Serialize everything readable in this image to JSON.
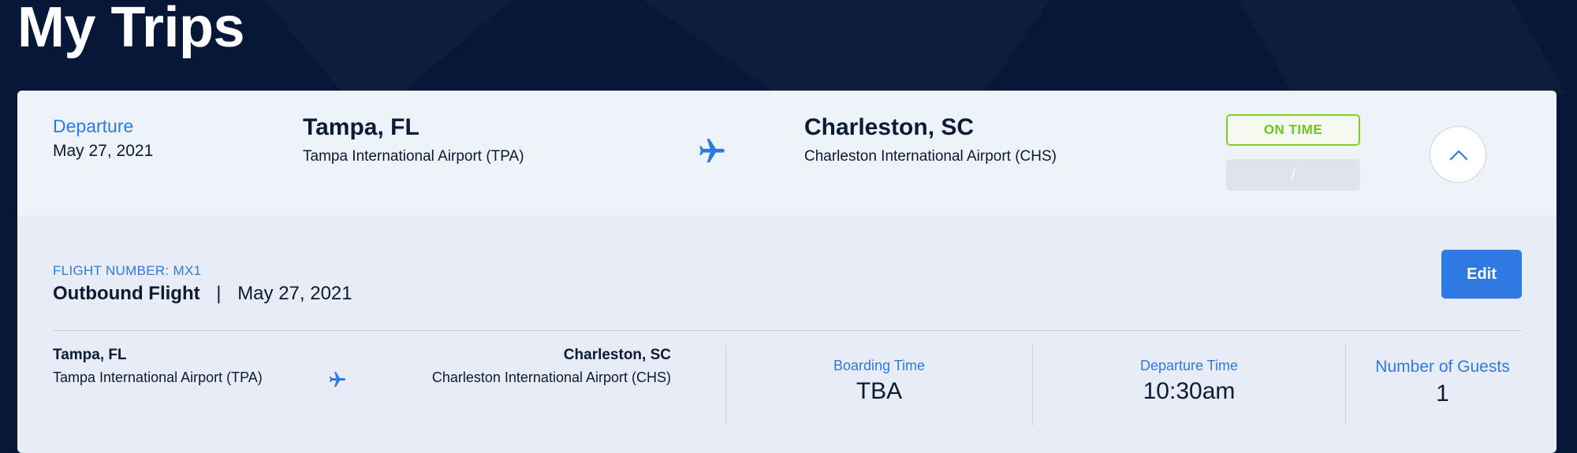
{
  "page": {
    "title": "My Trips"
  },
  "trip": {
    "departure_label": "Departure",
    "departure_date": "May 27, 2021",
    "origin": {
      "city": "Tampa, FL",
      "airport": "Tampa International Airport (TPA)"
    },
    "destination": {
      "city": "Charleston, SC",
      "airport": "Charleston International Airport (CHS)"
    },
    "status": "ON TIME",
    "time_range": "/",
    "colors": {
      "accent": "#2f7ae0",
      "status": "#7ed321",
      "background": "#061737"
    }
  },
  "details": {
    "flight_number": "FLIGHT NUMBER: MX1",
    "title": "Outbound Flight",
    "separator": "|",
    "date": "May 27, 2021",
    "edit_label": "Edit",
    "origin": {
      "city": "Tampa, FL",
      "airport": "Tampa International Airport (TPA)"
    },
    "destination": {
      "city": "Charleston, SC",
      "airport": "Charleston International Airport (CHS)"
    },
    "boarding": {
      "label": "Boarding Time",
      "value": "TBA"
    },
    "departure": {
      "label": "Departure Time",
      "value": "10:30am"
    },
    "guests": {
      "label": "Number of Guests",
      "value": "1"
    }
  },
  "icons": {
    "plane": "airplane-icon",
    "collapse": "chevron-up-icon"
  }
}
